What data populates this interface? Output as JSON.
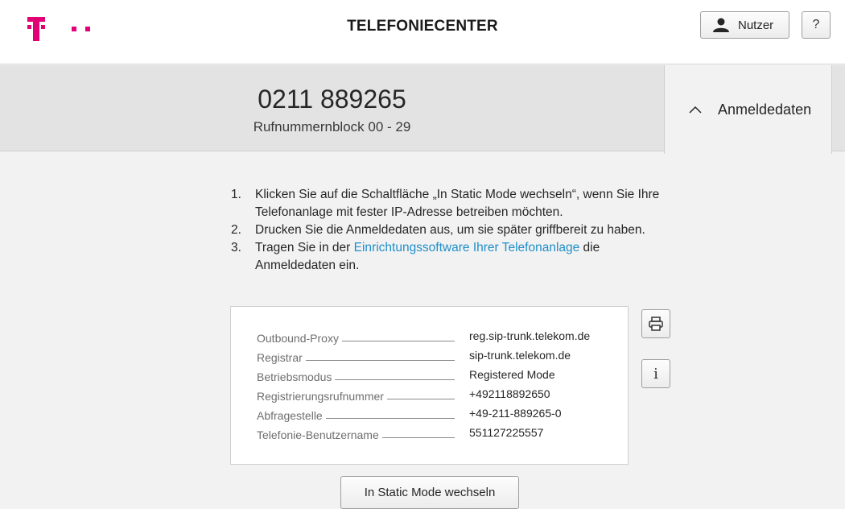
{
  "header": {
    "title": "TELEFONIECENTER",
    "brand_color": "#e20074",
    "user_button": "Nutzer",
    "help_button": "?"
  },
  "number_block": {
    "number": "0211 889265",
    "label": "Rufnummernblock 00 - 29"
  },
  "tab": {
    "label": "Anmeldedaten",
    "icon": "chevron-up-icon"
  },
  "steps": [
    {
      "n": "1.",
      "text": "Klicken Sie auf die Schaltfläche „In Static Mode wechseln“, wenn Sie Ihre Telefonanlage mit fester IP-Adresse betreiben möchten."
    },
    {
      "n": "2.",
      "text": "Drucken Sie die Anmeldedaten aus, um sie später griffbereit zu haben."
    },
    {
      "n": "3.",
      "pre": "Tragen Sie in der ",
      "link": "Einrichtungssoftware Ihrer Telefonanlage",
      "post": " die Anmeldedaten ein."
    }
  ],
  "credentials": [
    {
      "label": "Outbound-Proxy",
      "value": "reg.sip-trunk.telekom.de"
    },
    {
      "label": "Registrar",
      "value": "sip-trunk.telekom.de"
    },
    {
      "label": "Betriebsmodus",
      "value": "Registered Mode"
    },
    {
      "label": "Registrierungsrufnummer",
      "value": "+492118892650"
    },
    {
      "label": "Abfragestelle",
      "value": "+49-211-889265-0"
    },
    {
      "label": "Telefonie-Benutzername",
      "value": "551127225557"
    }
  ],
  "side_buttons": {
    "print_icon": "printer-icon",
    "info_label": "i"
  },
  "static_mode_button": "In Static Mode wechseln",
  "colors": {
    "link": "#1f8fc9",
    "band": "#e3e3e3",
    "background": "#f2f2f2"
  }
}
